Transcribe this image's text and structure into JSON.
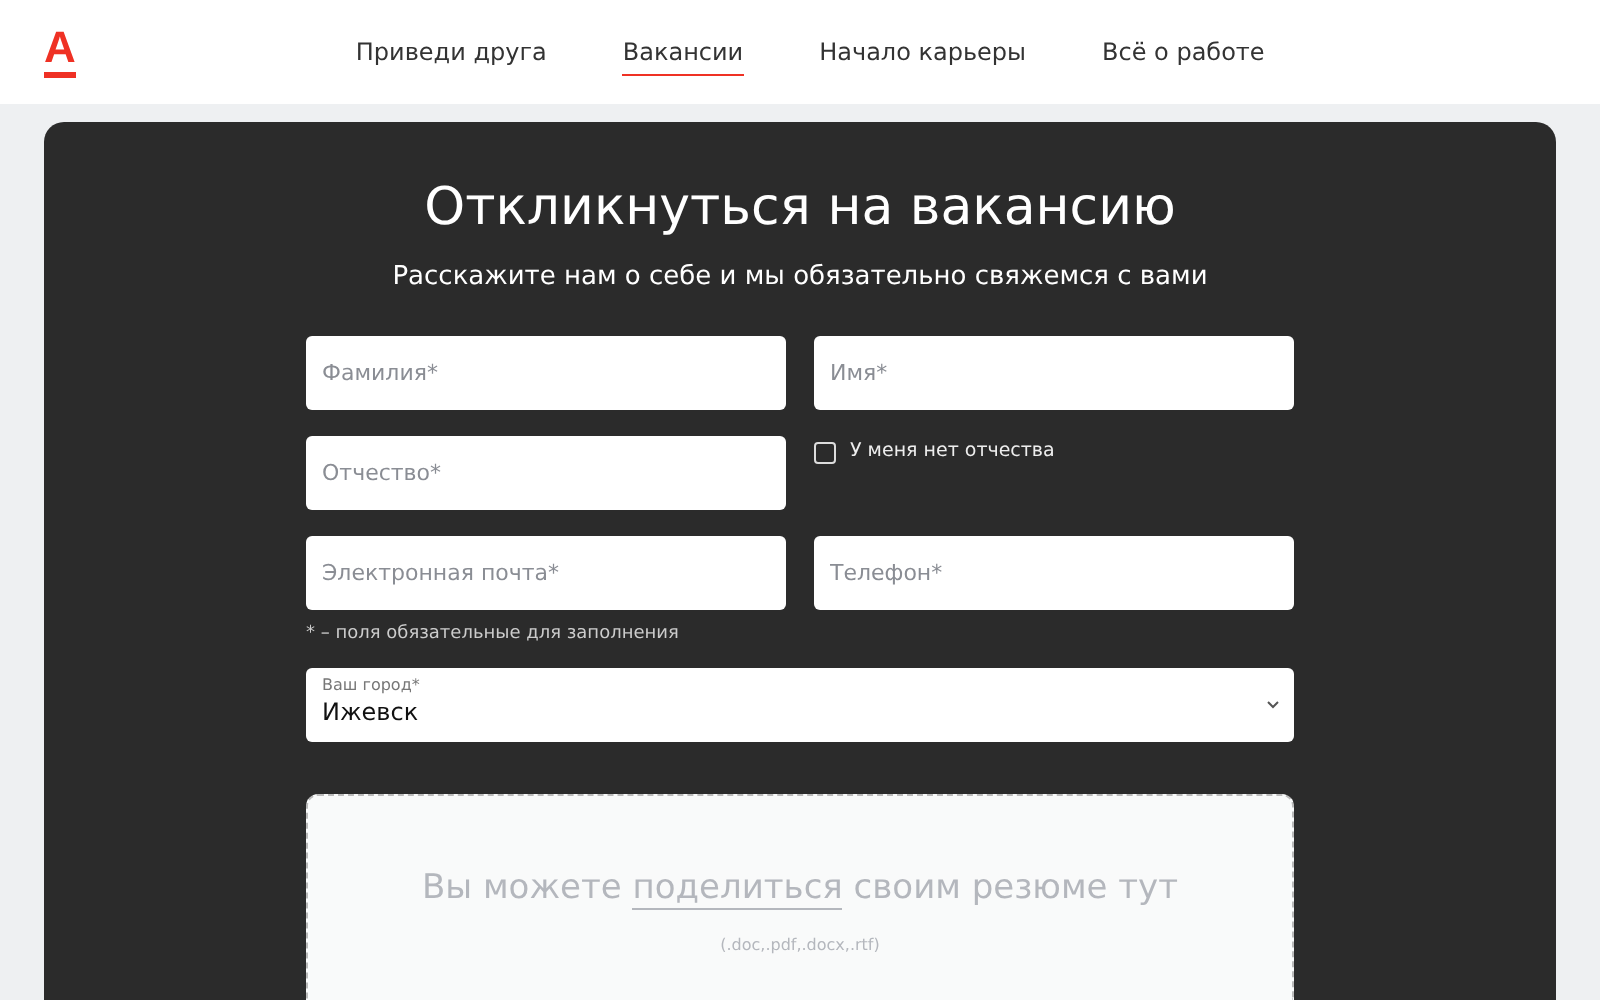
{
  "header": {
    "logo": "А",
    "nav": [
      {
        "label": "Приведи друга",
        "selected": false
      },
      {
        "label": "Вакансии",
        "selected": true
      },
      {
        "label": "Начало карьеры",
        "selected": false
      },
      {
        "label": "Всё о работе",
        "selected": false
      }
    ]
  },
  "form": {
    "title": "Откликнуться на вакансию",
    "subtitle": "Расскажите нам о себе и мы обязательно свяжемся с вами",
    "last_name": {
      "placeholder": "Фамилия*"
    },
    "first_name": {
      "placeholder": "Имя*"
    },
    "middle_name": {
      "placeholder": "Отчество*"
    },
    "no_middle_name": {
      "label": "У меня нет отчества",
      "checked": false
    },
    "email": {
      "placeholder": "Электронная почта*"
    },
    "phone": {
      "placeholder": "Телефон*"
    },
    "required_note": "* – поля обязательные для заполнения",
    "city": {
      "label": "Ваш город*",
      "value": "Ижевск"
    },
    "upload": {
      "text_before": "Вы можете",
      "link": "поделиться",
      "text_after": "своим резюме тут",
      "formats": "(.doc,.pdf,.docx,.rtf)"
    }
  }
}
